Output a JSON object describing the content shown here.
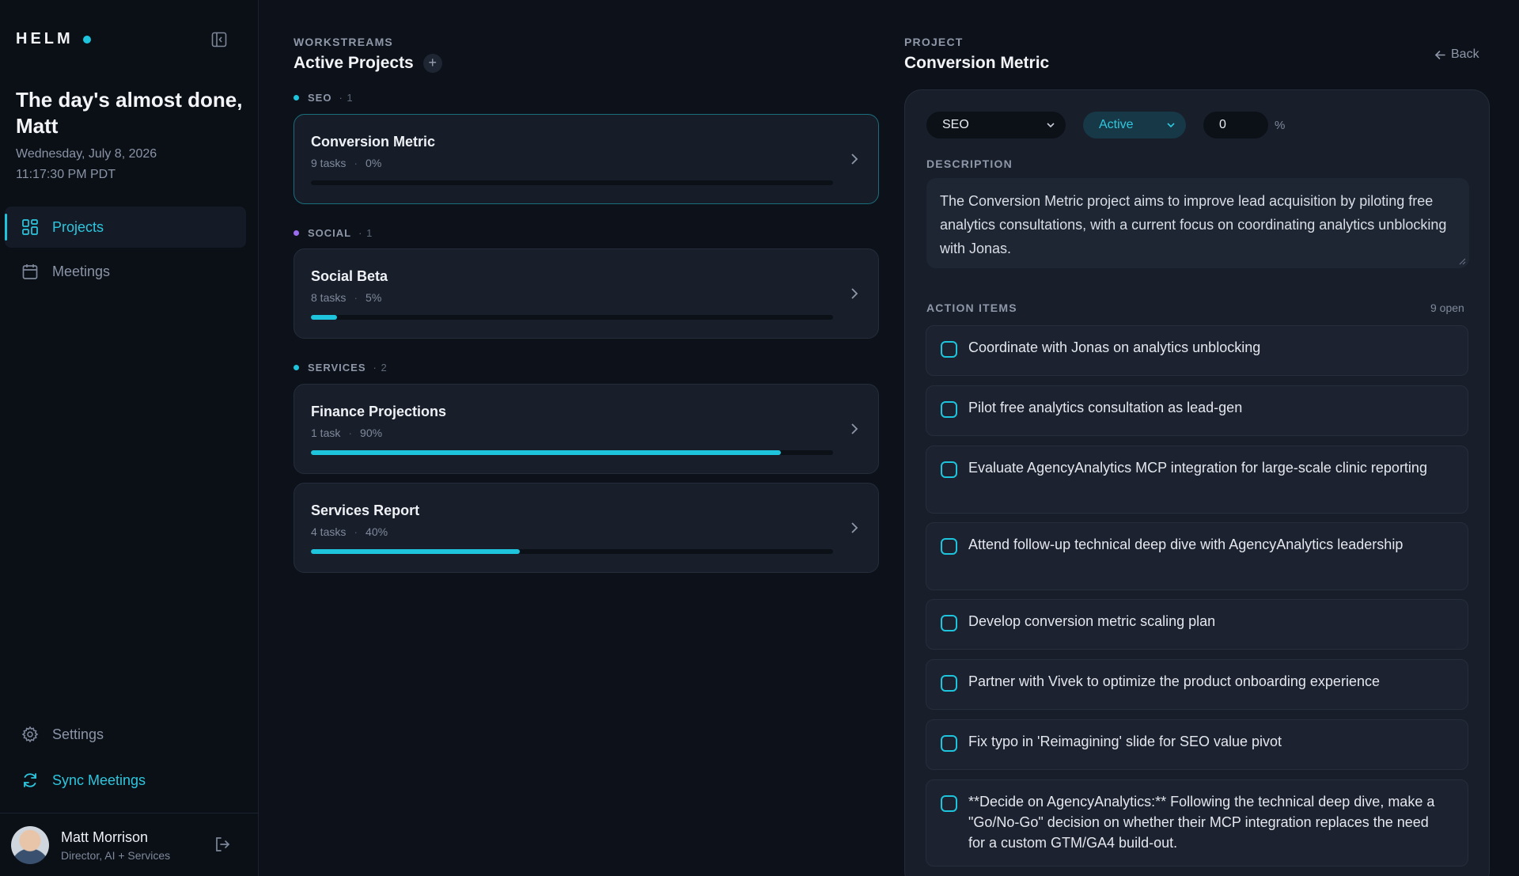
{
  "app": {
    "name": "HELM",
    "accent": "#1ec4dc"
  },
  "sidebar": {
    "greeting": "The day's almost done, Matt",
    "date": "Wednesday, July 8, 2026",
    "time": "11:17:30 PM PDT",
    "nav": {
      "projects": "Projects",
      "meetings": "Meetings"
    },
    "settings": "Settings",
    "sync": "Sync Meetings",
    "user": {
      "name": "Matt Morrison",
      "role": "Director, AI + Services"
    }
  },
  "workstreams": {
    "eyebrow": "WORKSTREAMS",
    "title": "Active Projects",
    "add": "+",
    "groups": [
      {
        "label": "SEO",
        "count": "· 1",
        "color": "#1ec4dc"
      },
      {
        "label": "SOCIAL",
        "count": "· 1",
        "color": "#9b6cf0"
      },
      {
        "label": "SERVICES",
        "count": "· 2",
        "color": "#1ec4dc"
      }
    ],
    "projects": [
      {
        "name": "Conversion Metric",
        "tasks": "9 tasks",
        "percent": "0%",
        "progress": 0
      },
      {
        "name": "Social Beta",
        "tasks": "8 tasks",
        "percent": "5%",
        "progress": 5
      },
      {
        "name": "Finance Projections",
        "tasks": "1 task",
        "percent": "90%",
        "progress": 90
      },
      {
        "name": "Services Report",
        "tasks": "4 tasks",
        "percent": "40%",
        "progress": 40
      }
    ]
  },
  "detail": {
    "eyebrow": "PROJECT",
    "title": "Conversion Metric",
    "back": "Back",
    "category": "SEO",
    "status": "Active",
    "percent_value": "0",
    "percent_sign": "%",
    "description_label": "DESCRIPTION",
    "description": "The Conversion Metric project aims to improve lead acquisition by piloting free analytics consultations, with a current focus on coordinating analytics unblocking with Jonas.",
    "action_items_label": "ACTION ITEMS",
    "open_count": "9 open",
    "action_items": [
      "Coordinate with Jonas on analytics unblocking",
      "Pilot free analytics consultation as lead-gen",
      "Evaluate AgencyAnalytics MCP integration for large-scale clinic reporting",
      "Attend follow-up technical deep dive with AgencyAnalytics leadership",
      "Develop conversion metric scaling plan",
      "Partner with Vivek to optimize the product onboarding experience",
      "Fix typo in 'Reimagining' slide for SEO value pivot",
      "**Decide on AgencyAnalytics:** Following the technical deep dive, make a \"Go/No-Go\" decision on whether their MCP integration replaces the need for a custom GTM/GA4 build-out."
    ]
  }
}
